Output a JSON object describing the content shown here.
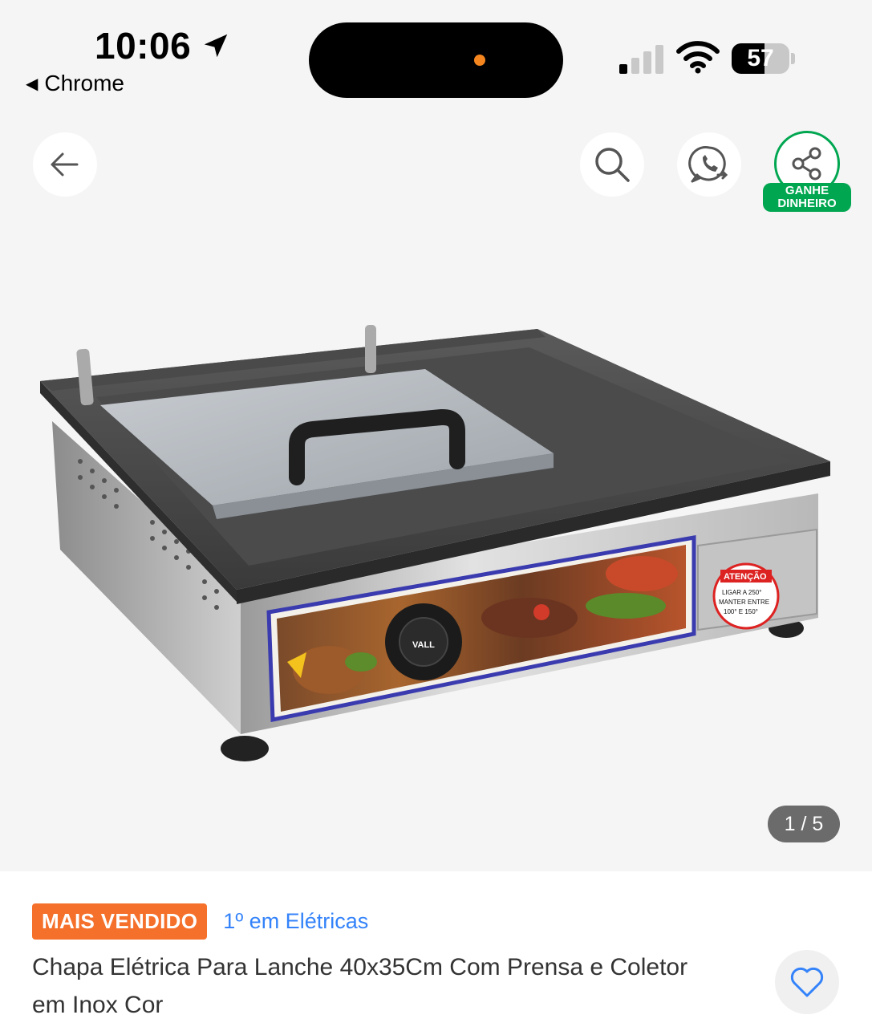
{
  "status_bar": {
    "time": "10:06",
    "back_app": "Chrome",
    "battery_level": "57",
    "battery_fraction": 0.57
  },
  "gallery": {
    "share_badge_line1": "GANHE",
    "share_badge_line2": "DINHEIRO",
    "counter": "1 / 5",
    "product_labels": {
      "warning_title": "ATENÇÃO",
      "warning_text_1": "LIGAR A 250°",
      "warning_text_2": "MANTER ENTRE",
      "warning_text_3": "100° E 150°",
      "brand": "VALL"
    }
  },
  "product": {
    "badge": "MAIS VENDIDO",
    "rank": "1º em Elétricas",
    "title": "Chapa Elétrica Para Lanche 40x35Cm Com Prensa e Coletor em Inox Cor"
  },
  "icons": {
    "back": "arrow-left-icon",
    "search": "search-icon",
    "whatsapp": "whatsapp-icon",
    "share": "share-icon",
    "favorite": "heart-icon"
  },
  "colors": {
    "accent_green": "#00a650",
    "badge_orange": "#f5702b",
    "link_blue": "#3483fa"
  }
}
